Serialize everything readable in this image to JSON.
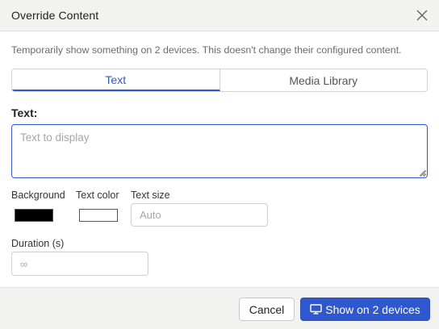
{
  "dialog": {
    "title": "Override Content",
    "description": "Temporarily show something on 2 devices. This doesn't change their configured content."
  },
  "tabs": [
    {
      "label": "Text",
      "active": true
    },
    {
      "label": "Media Library",
      "active": false
    }
  ],
  "text_field": {
    "label": "Text:",
    "value": "",
    "placeholder": "Text to display"
  },
  "background": {
    "label": "Background",
    "color": "#000000"
  },
  "text_color": {
    "label": "Text color",
    "color": "#ffffff"
  },
  "text_size": {
    "label": "Text size",
    "value": "",
    "placeholder": "Auto"
  },
  "duration": {
    "label": "Duration (s)",
    "value": "",
    "placeholder": "∞"
  },
  "footer": {
    "cancel_label": "Cancel",
    "submit_label": "Show on 2 devices",
    "submit_icon": "monitor-icon"
  },
  "colors": {
    "accent": "#2f58cf",
    "header_bg": "#f2f2f1"
  }
}
